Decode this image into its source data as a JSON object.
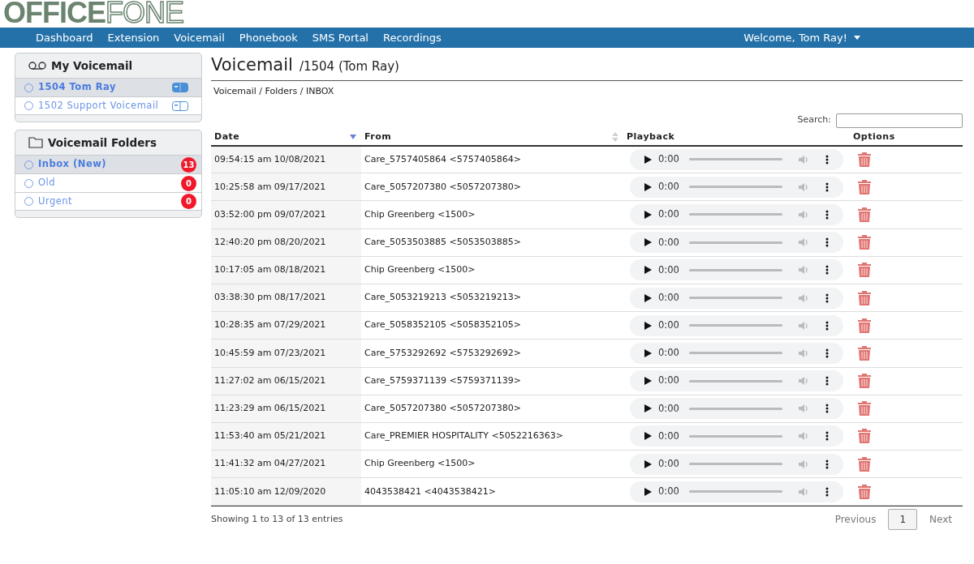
{
  "logo": {
    "part_1": "OFFICE",
    "part_2": "FONE"
  },
  "nav": {
    "items": [
      "Dashboard",
      "Extension",
      "Voicemail",
      "Phonebook",
      "SMS Portal",
      "Recordings"
    ],
    "user": "Welcome, Tom Ray!"
  },
  "my_voicemail": {
    "title": "My Voicemail",
    "items": [
      {
        "label": "1504 Tom Ray",
        "selected": true
      },
      {
        "label": "1502 Support Voicemail",
        "selected": false
      }
    ]
  },
  "folders": {
    "title": "Voicemail Folders",
    "items": [
      {
        "label": "Inbox (New)",
        "count": "13",
        "selected": true
      },
      {
        "label": "Old",
        "count": "0",
        "selected": false
      },
      {
        "label": "Urgent",
        "count": "0",
        "selected": false
      }
    ]
  },
  "page": {
    "title": "Voicemail",
    "subtitle": "/1504 (Tom Ray)",
    "breadcrumb": "Voicemail / Folders / INBOX"
  },
  "search": {
    "label": "Search:"
  },
  "table": {
    "columns": [
      {
        "label": "Date",
        "sortable": true,
        "sorted": true
      },
      {
        "label": "From",
        "sortable": true,
        "sorted": false
      },
      {
        "label": "Playback"
      },
      {
        "label": "Options"
      }
    ],
    "rows": [
      {
        "date": "09:54:15 am 10/08/2021",
        "from": "Care_5757405864 <5757405864>",
        "time": "0:00"
      },
      {
        "date": "10:25:58 am 09/17/2021",
        "from": "Care_5057207380 <5057207380>",
        "time": "0:00"
      },
      {
        "date": "03:52:00 pm 09/07/2021",
        "from": "Chip Greenberg <1500>",
        "time": "0:00"
      },
      {
        "date": "12:40:20 pm 08/20/2021",
        "from": "Care_5053503885 <5053503885>",
        "time": "0:00"
      },
      {
        "date": "10:17:05 am 08/18/2021",
        "from": "Chip Greenberg <1500>",
        "time": "0:00"
      },
      {
        "date": "03:38:30 pm 08/17/2021",
        "from": "Care_5053219213 <5053219213>",
        "time": "0:00"
      },
      {
        "date": "10:28:35 am 07/29/2021",
        "from": "Care_5058352105 <5058352105>",
        "time": "0:00"
      },
      {
        "date": "10:45:59 am 07/23/2021",
        "from": "Care_5753292692 <5753292692>",
        "time": "0:00"
      },
      {
        "date": "11:27:02 am 06/15/2021",
        "from": "Care_5759371139 <5759371139>",
        "time": "0:00"
      },
      {
        "date": "11:23:29 am 06/15/2021",
        "from": "Care_5057207380 <5057207380>",
        "time": "0:00"
      },
      {
        "date": "11:53:40 am 05/21/2021",
        "from": "Care_PREMIER HOSPITALITY <5052216363>",
        "time": "0:00"
      },
      {
        "date": "11:41:32 am 04/27/2021",
        "from": "Chip Greenberg <1500>",
        "time": "0:00"
      },
      {
        "date": "11:05:10 am 12/09/2020",
        "from": "4043538421 <4043538421>",
        "time": "0:00"
      }
    ]
  },
  "footer": {
    "info": "Showing 1 to 13 of 13 entries",
    "pagination": [
      {
        "label": "Previous",
        "selected": false
      },
      {
        "label": "1",
        "selected": true
      },
      {
        "label": "Next",
        "selected": false
      }
    ]
  }
}
